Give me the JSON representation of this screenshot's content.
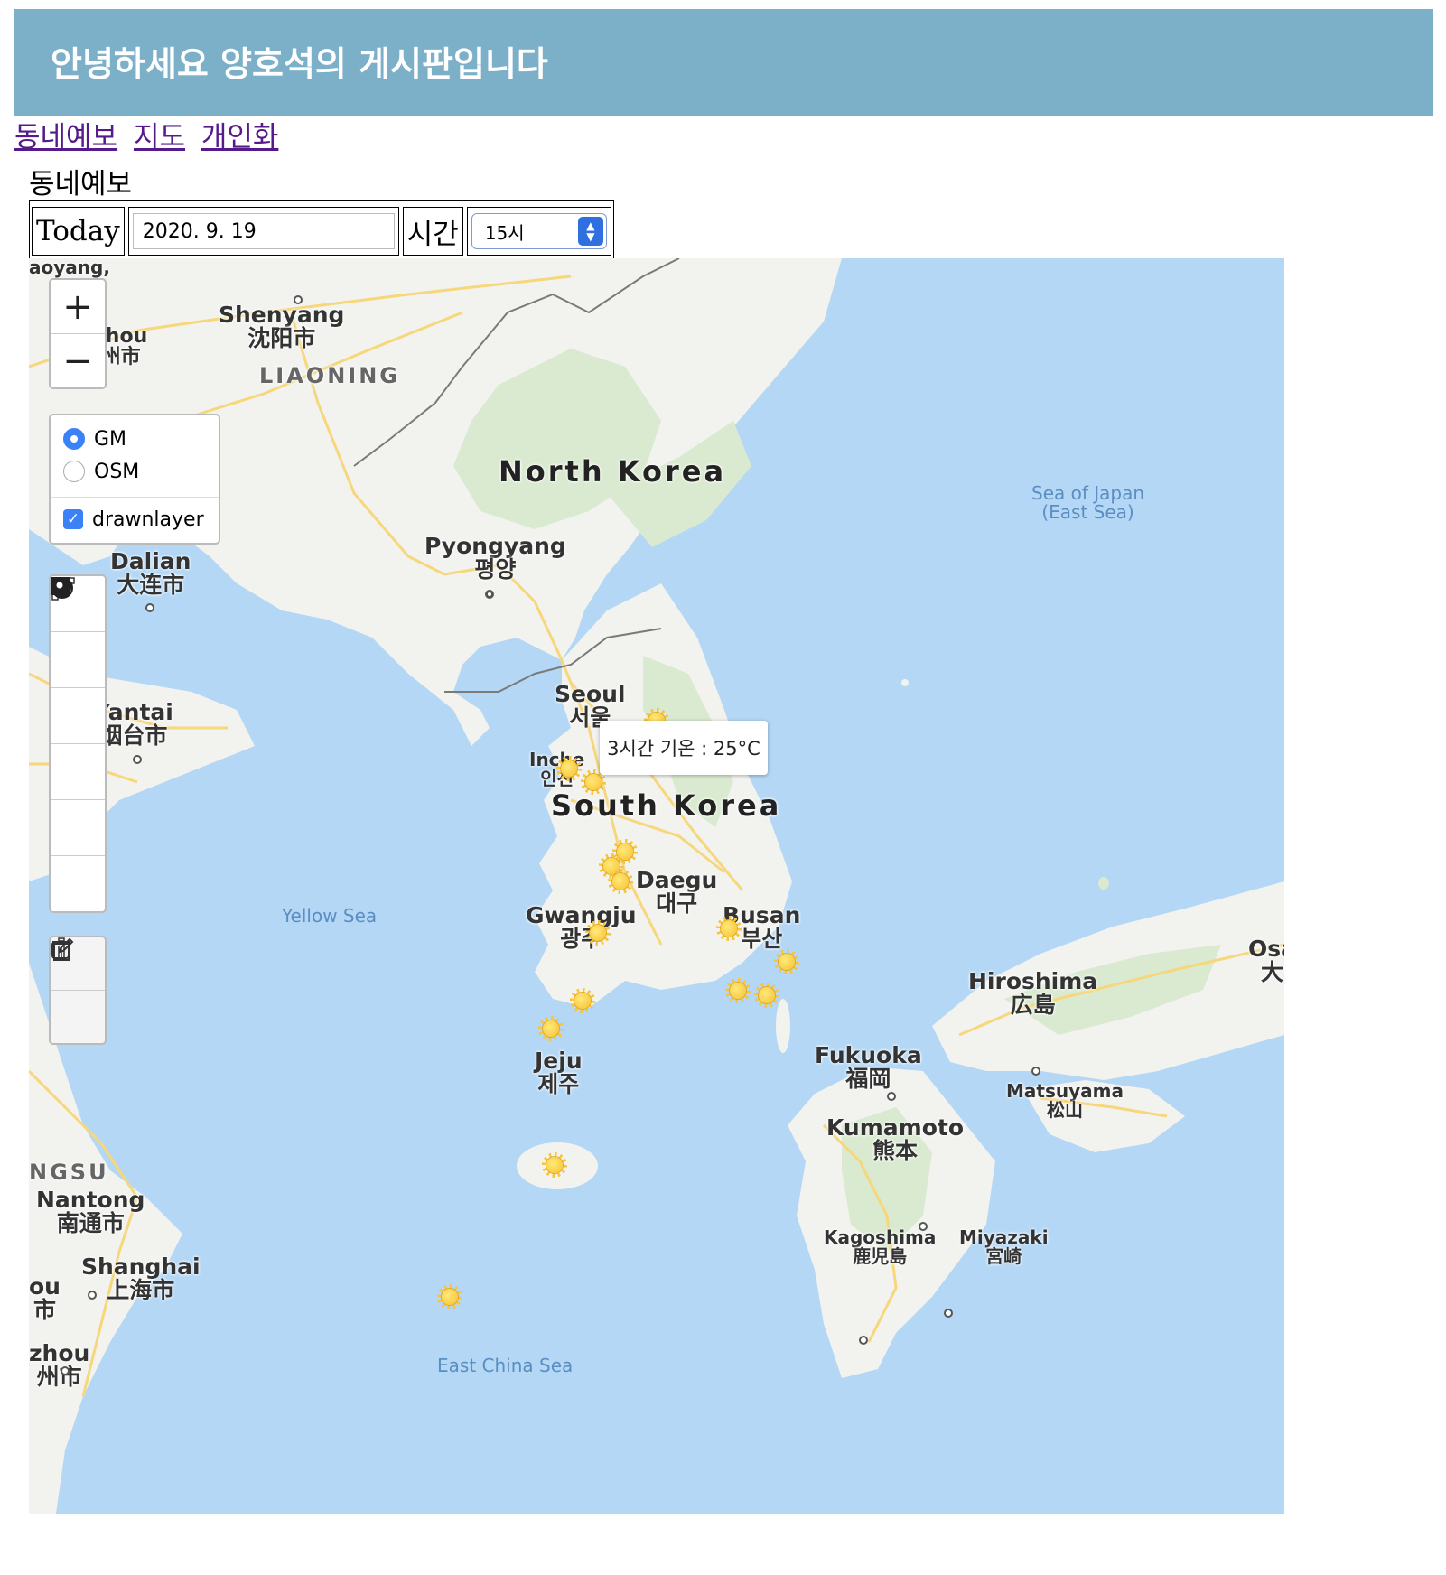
{
  "header": {
    "title": "안녕하세요 양호석의 게시판입니다"
  },
  "nav": {
    "items": [
      "동네예보",
      "지도",
      "개인화"
    ]
  },
  "section": {
    "title": "동네예보"
  },
  "controls": {
    "today_label": "Today",
    "date_value": "2020. 9. 19",
    "time_label": "시간",
    "time_selected": "15시"
  },
  "map": {
    "zoom_in": "+",
    "zoom_out": "−",
    "layers": {
      "base_gm": "GM",
      "base_osm": "OSM",
      "overlay": "drawnlayer",
      "selected_base": "GM",
      "overlay_checked": true
    },
    "tooltip": "3시간 기온 : 25°C",
    "labels": {
      "north_korea": "North Korea",
      "south_korea": "South Korea",
      "liaoning": "LIAONING",
      "jiangsu": "NGSU",
      "shenyang": "Shenyang\n沈阳市",
      "dalian": "Dalian\n大连市",
      "yantai": "Yantai\n烟台市",
      "pyongyang": "Pyongyang\n평양",
      "seoul": "Seoul\n서울",
      "incheon": "Inche\n인천",
      "daegu": "Daegu\n대구",
      "gwangju": "Gwangju\n광주",
      "busan": "Busan\n부산",
      "jeju": "Jeju\n제주",
      "fukuoka": "Fukuoka\n福岡",
      "hiroshima": "Hiroshima\n広島",
      "kumamoto": "Kumamoto\n熊本",
      "matsuyama": "Matsuyama\n松山",
      "kagoshima": "Kagoshima\n鹿児島",
      "miyazaki": "Miyazaki\n宮崎",
      "osaka": "Osa\n大",
      "nantong": "Nantong\n南通市",
      "shanghai": "Shanghai\n上海市",
      "zhou_top": "zhou\n州市",
      "zhou_bottom": "zhou\n州市",
      "ou_left": "ou\n市",
      "haoyang": "aoyang,",
      "sea_of_japan": "Sea of Japan\n(East Sea)",
      "yellow_sea": "Yellow Sea",
      "east_china_sea": "East China Sea"
    },
    "weather_icon": "sun-icon",
    "colors": {
      "water": "#b3d7f5",
      "land": "#f2f2ef",
      "park": "#d9ead0",
      "road": "#f7d77b",
      "border": "#7a7a7a"
    }
  }
}
